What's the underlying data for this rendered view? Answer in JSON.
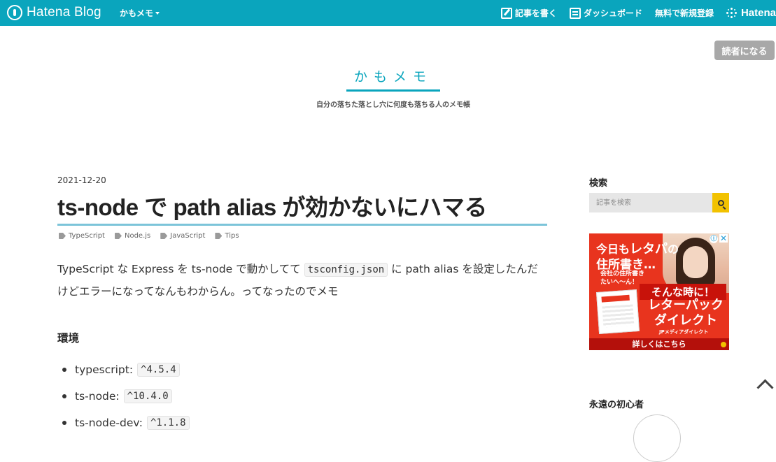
{
  "topbar": {
    "logo_text": "Hatena Blog",
    "blog_menu_label": "かもメモ",
    "write_label": "記事を書く",
    "dashboard_label": "ダッシュボード",
    "signup_label": "無料で新規登録",
    "hatena_label": "Hatena"
  },
  "reader_button_label": "読者になる",
  "blog": {
    "title": "かもメモ",
    "description": "自分の落ちた落とし穴に何度も落ちる人のメモ帳"
  },
  "article": {
    "date": "2021-12-20",
    "title": "ts-node で path alias が効かないにハマる",
    "tags": [
      "TypeScript",
      "Node.js",
      "JavaScript",
      "Tips"
    ],
    "lead_part1": "TypeScript な Express を ts-node で動かしてて ",
    "lead_code": "tsconfig.json",
    "lead_part2": " に path alias を設定したんだけどエラーになってなんもわからん。ってなったのでメモ",
    "env_heading": "環境",
    "env_items": [
      {
        "name": "typescript:",
        "version": "^4.5.4"
      },
      {
        "name": "ts-node:",
        "version": "^10.4.0"
      },
      {
        "name": "ts-node-dev:",
        "version": "^1.1.8"
      }
    ]
  },
  "sidebar": {
    "search_heading": "検索",
    "search_placeholder": "記事を検索",
    "profile_heading": "永遠の初心者"
  },
  "ad": {
    "line1_a": "今日も",
    "line1_b": "レタパ",
    "line1_c": "の",
    "line2": "住所書き…",
    "small_1": "会社の住所書き",
    "small_2": "たいへ〜ん！",
    "headline": "そんな時に！",
    "big_1": "レターパック",
    "big_2": "ダイレクト",
    "sub": "JPメディアダイレクト",
    "footer": "詳しくはこちら",
    "info_icon": "ⓘ",
    "close_icon": "✕"
  },
  "colors": {
    "brand": "#0aa5bd",
    "search_button": "#f2c200",
    "ad_red": "#e8341e"
  }
}
